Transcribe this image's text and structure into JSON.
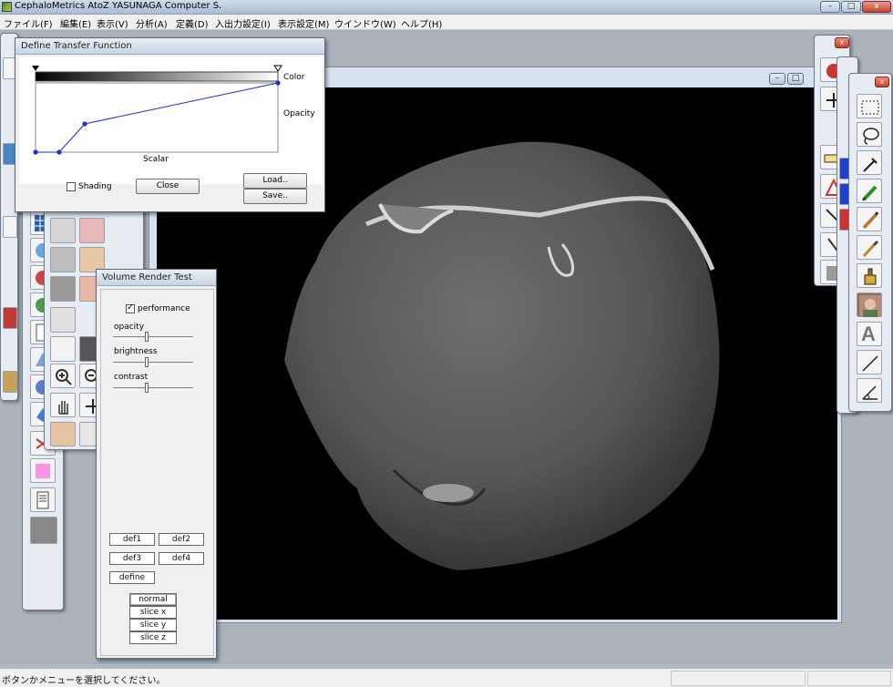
{
  "window": {
    "title": "CephaloMetrics AtoZ  YASUNAGA Computer S.",
    "min": "–",
    "max": "□",
    "close": "x"
  },
  "menu": [
    {
      "label": "ファイル(F)"
    },
    {
      "label": "編集(E)"
    },
    {
      "label": "表示(V)"
    },
    {
      "label": "分析(A)"
    },
    {
      "label": "定義(D)"
    },
    {
      "label": "入出力設定(I)"
    },
    {
      "label": "表示設定(M)"
    },
    {
      "label": "ウインドウ(W)"
    },
    {
      "label": "ヘルプ(H)"
    }
  ],
  "status": {
    "text": "ボタンかメニューを選択してください。"
  },
  "transfer": {
    "title": "Define Transfer Function",
    "color_label": "Color",
    "opacity_label": "Opacity",
    "scalar_label": "Scalar",
    "shading_label": "Shading",
    "shading_checked": false,
    "close_label": "Close",
    "load_label": "Load..",
    "save_label": "Save.."
  },
  "volume": {
    "title": "Volume Render Test",
    "performance_label": "performance",
    "performance_checked": true,
    "opacity_label": "opacity",
    "brightness_label": "brightness",
    "contrast_label": "contrast",
    "opacity_value": 0.42,
    "brightness_value": 0.42,
    "contrast_value": 0.42,
    "def1": "def1",
    "def2": "def2",
    "def3": "def3",
    "def4": "def4",
    "define": "define",
    "modes": [
      "normal",
      "slice x",
      "slice y",
      "slice z"
    ],
    "selected_mode": "normal"
  },
  "viewer": {
    "min": "–",
    "max": "□"
  },
  "right_toolbar": {
    "icons": [
      "marquee-select-icon",
      "lasso-icon",
      "eyedropper-icon",
      "pencil-icon",
      "brush-icon",
      "paintbrush-icon",
      "paint-bucket-icon",
      "photo-thumbnail-icon",
      "text-tool-icon",
      "line-tool-icon",
      "angle-tool-icon"
    ],
    "text_tool_glyph": "A"
  }
}
